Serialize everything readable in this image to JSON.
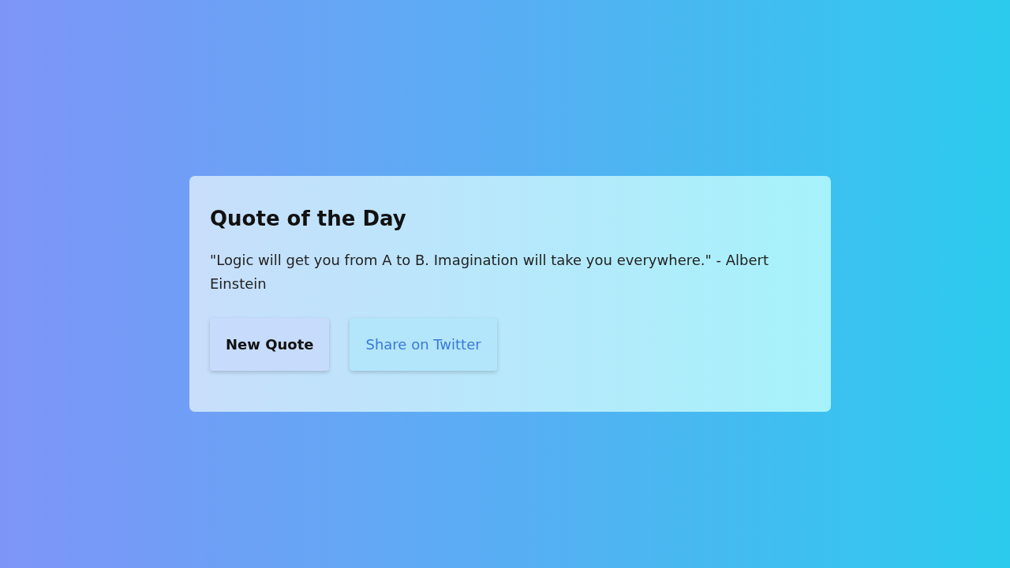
{
  "card": {
    "title": "Quote of the Day",
    "quote": "\"Logic will get you from A to B. Imagination will take you everywhere.\" - Albert Einstein",
    "buttons": [
      {
        "label": "New Quote",
        "kind": "primary"
      },
      {
        "label": "Share on Twitter",
        "kind": "link"
      }
    ]
  }
}
